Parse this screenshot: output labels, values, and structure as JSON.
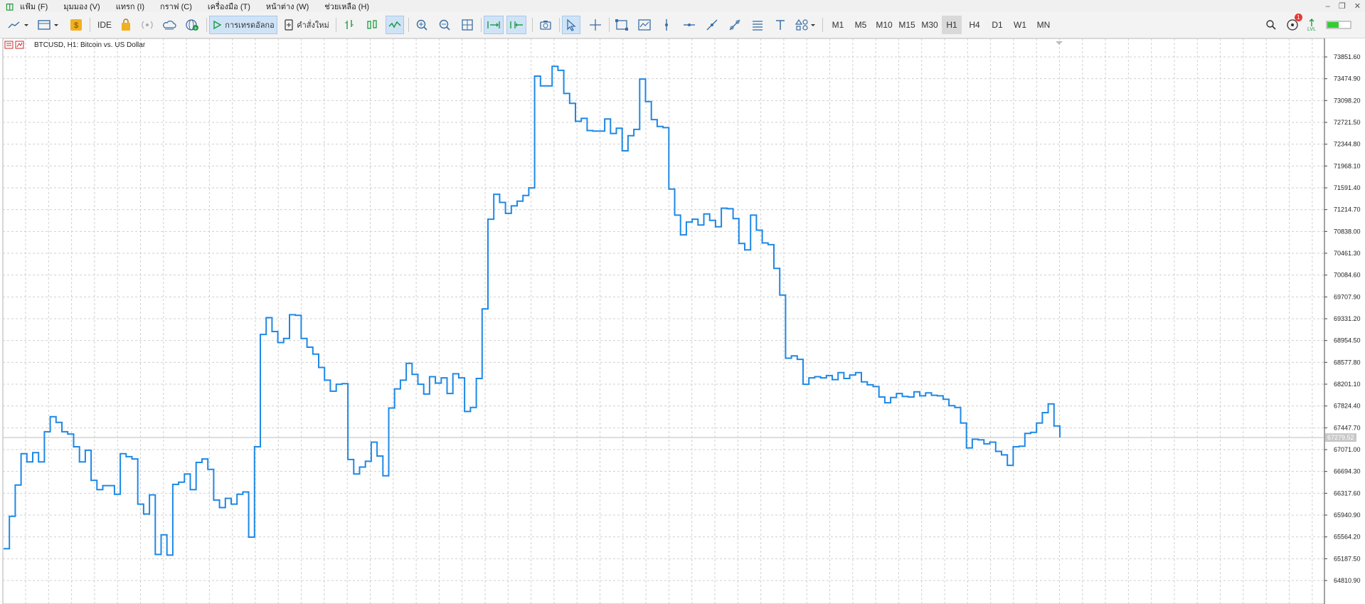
{
  "menu": [
    "แฟ้ม (F)",
    "มุมมอง (V)",
    "แทรก (I)",
    "กราฟ (C)",
    "เครื่องมือ (T)",
    "หน้าต่าง (W)",
    "ช่วยเหลือ (H)"
  ],
  "toolbar": {
    "ide_label": "IDE",
    "algo_label": "การเทรดอัลกอ",
    "new_order_label": "คำสั่งใหม่",
    "notification_count": "1",
    "lvl_label": "LVL",
    "timeframes": [
      "M1",
      "M5",
      "M10",
      "M15",
      "M30",
      "H1",
      "H4",
      "D1",
      "W1",
      "MN"
    ],
    "active_timeframe": "H1"
  },
  "chart_title": "BTCUSD, H1:  Bitcoin vs. US Dollar",
  "chart_data": {
    "type": "line",
    "series_color": "#1e88e5",
    "grid": true,
    "ylim": [
      64810.9,
      74134.0
    ],
    "y_ticks": [
      "73851.60",
      "73474.90",
      "73098.20",
      "72721.50",
      "72344.80",
      "71968.10",
      "71591.40",
      "71214.70",
      "70838.00",
      "70461.30",
      "70084.60",
      "69707.90",
      "69331.20",
      "68954.50",
      "68577.80",
      "68201.10",
      "67824.40",
      "67447.70",
      "67071.00",
      "66694.30",
      "66317.60",
      "65940.90",
      "65564.20",
      "65187.50",
      "64810.90"
    ],
    "current_price": "67279.52",
    "values": [
      65360,
      65920,
      66460,
      67000,
      66860,
      67020,
      66860,
      67380,
      67640,
      67540,
      67380,
      67340,
      67120,
      66860,
      67060,
      66540,
      66380,
      66450,
      66450,
      66300,
      67000,
      66950,
      66910,
      66130,
      65960,
      66290,
      65260,
      65600,
      65250,
      66470,
      66510,
      66650,
      66380,
      66850,
      66910,
      66730,
      66200,
      66070,
      66230,
      66130,
      66300,
      66340,
      65560,
      67120,
      69060,
      69350,
      69110,
      68920,
      68990,
      69400,
      69390,
      68990,
      68840,
      68720,
      68490,
      68270,
      68080,
      68200,
      68210,
      66900,
      66650,
      66770,
      66870,
      67200,
      66960,
      66620,
      67790,
      68120,
      68270,
      68560,
      68370,
      68200,
      68030,
      68330,
      68220,
      68310,
      68040,
      68380,
      68310,
      67730,
      67800,
      68300,
      69500,
      71050,
      71480,
      71340,
      71150,
      71280,
      71360,
      71460,
      71590,
      73520,
      73350,
      73350,
      73690,
      73620,
      73220,
      73050,
      72740,
      72790,
      72580,
      72570,
      72570,
      72780,
      72530,
      72620,
      72230,
      72490,
      72600,
      73470,
      73080,
      72770,
      72650,
      72630,
      71570,
      71120,
      70780,
      71000,
      71050,
      70950,
      71140,
      71030,
      70920,
      71240,
      71230,
      71060,
      70630,
      70520,
      71120,
      70860,
      70640,
      70610,
      70200,
      69740,
      68650,
      68690,
      68630,
      68200,
      68310,
      68330,
      68310,
      68350,
      68280,
      68400,
      68300,
      68360,
      68400,
      68240,
      68190,
      68160,
      67980,
      67880,
      67970,
      68040,
      67990,
      67980,
      68070,
      68000,
      68050,
      68010,
      68000,
      67940,
      67830,
      67800,
      67530,
      67100,
      67250,
      67240,
      67170,
      67200,
      67040,
      66980,
      66800,
      67120,
      67130,
      67350,
      67370,
      67530,
      67710,
      67860,
      67480,
      67280
    ]
  }
}
